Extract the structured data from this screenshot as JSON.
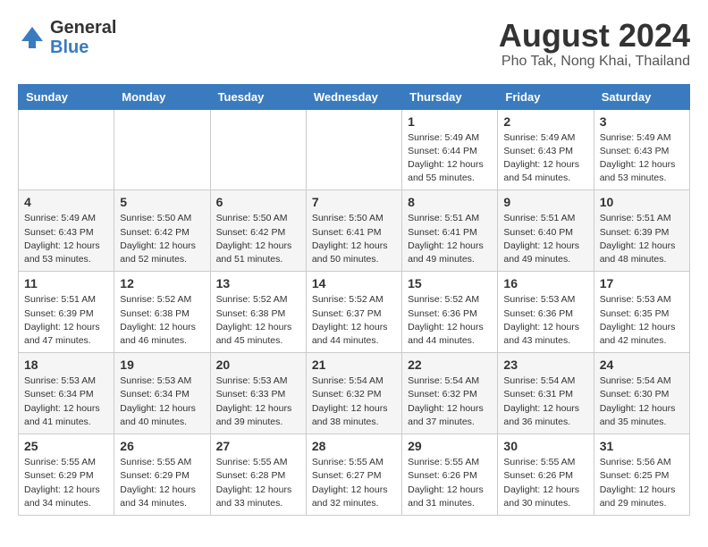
{
  "header": {
    "logo_general": "General",
    "logo_blue": "Blue",
    "title": "August 2024",
    "subtitle": "Pho Tak, Nong Khai, Thailand"
  },
  "calendar": {
    "days_of_week": [
      "Sunday",
      "Monday",
      "Tuesday",
      "Wednesday",
      "Thursday",
      "Friday",
      "Saturday"
    ],
    "weeks": [
      [
        {
          "day": "",
          "info": ""
        },
        {
          "day": "",
          "info": ""
        },
        {
          "day": "",
          "info": ""
        },
        {
          "day": "",
          "info": ""
        },
        {
          "day": "1",
          "info": "Sunrise: 5:49 AM\nSunset: 6:44 PM\nDaylight: 12 hours\nand 55 minutes."
        },
        {
          "day": "2",
          "info": "Sunrise: 5:49 AM\nSunset: 6:43 PM\nDaylight: 12 hours\nand 54 minutes."
        },
        {
          "day": "3",
          "info": "Sunrise: 5:49 AM\nSunset: 6:43 PM\nDaylight: 12 hours\nand 53 minutes."
        }
      ],
      [
        {
          "day": "4",
          "info": "Sunrise: 5:49 AM\nSunset: 6:43 PM\nDaylight: 12 hours\nand 53 minutes."
        },
        {
          "day": "5",
          "info": "Sunrise: 5:50 AM\nSunset: 6:42 PM\nDaylight: 12 hours\nand 52 minutes."
        },
        {
          "day": "6",
          "info": "Sunrise: 5:50 AM\nSunset: 6:42 PM\nDaylight: 12 hours\nand 51 minutes."
        },
        {
          "day": "7",
          "info": "Sunrise: 5:50 AM\nSunset: 6:41 PM\nDaylight: 12 hours\nand 50 minutes."
        },
        {
          "day": "8",
          "info": "Sunrise: 5:51 AM\nSunset: 6:41 PM\nDaylight: 12 hours\nand 49 minutes."
        },
        {
          "day": "9",
          "info": "Sunrise: 5:51 AM\nSunset: 6:40 PM\nDaylight: 12 hours\nand 49 minutes."
        },
        {
          "day": "10",
          "info": "Sunrise: 5:51 AM\nSunset: 6:39 PM\nDaylight: 12 hours\nand 48 minutes."
        }
      ],
      [
        {
          "day": "11",
          "info": "Sunrise: 5:51 AM\nSunset: 6:39 PM\nDaylight: 12 hours\nand 47 minutes."
        },
        {
          "day": "12",
          "info": "Sunrise: 5:52 AM\nSunset: 6:38 PM\nDaylight: 12 hours\nand 46 minutes."
        },
        {
          "day": "13",
          "info": "Sunrise: 5:52 AM\nSunset: 6:38 PM\nDaylight: 12 hours\nand 45 minutes."
        },
        {
          "day": "14",
          "info": "Sunrise: 5:52 AM\nSunset: 6:37 PM\nDaylight: 12 hours\nand 44 minutes."
        },
        {
          "day": "15",
          "info": "Sunrise: 5:52 AM\nSunset: 6:36 PM\nDaylight: 12 hours\nand 44 minutes."
        },
        {
          "day": "16",
          "info": "Sunrise: 5:53 AM\nSunset: 6:36 PM\nDaylight: 12 hours\nand 43 minutes."
        },
        {
          "day": "17",
          "info": "Sunrise: 5:53 AM\nSunset: 6:35 PM\nDaylight: 12 hours\nand 42 minutes."
        }
      ],
      [
        {
          "day": "18",
          "info": "Sunrise: 5:53 AM\nSunset: 6:34 PM\nDaylight: 12 hours\nand 41 minutes."
        },
        {
          "day": "19",
          "info": "Sunrise: 5:53 AM\nSunset: 6:34 PM\nDaylight: 12 hours\nand 40 minutes."
        },
        {
          "day": "20",
          "info": "Sunrise: 5:53 AM\nSunset: 6:33 PM\nDaylight: 12 hours\nand 39 minutes."
        },
        {
          "day": "21",
          "info": "Sunrise: 5:54 AM\nSunset: 6:32 PM\nDaylight: 12 hours\nand 38 minutes."
        },
        {
          "day": "22",
          "info": "Sunrise: 5:54 AM\nSunset: 6:32 PM\nDaylight: 12 hours\nand 37 minutes."
        },
        {
          "day": "23",
          "info": "Sunrise: 5:54 AM\nSunset: 6:31 PM\nDaylight: 12 hours\nand 36 minutes."
        },
        {
          "day": "24",
          "info": "Sunrise: 5:54 AM\nSunset: 6:30 PM\nDaylight: 12 hours\nand 35 minutes."
        }
      ],
      [
        {
          "day": "25",
          "info": "Sunrise: 5:55 AM\nSunset: 6:29 PM\nDaylight: 12 hours\nand 34 minutes."
        },
        {
          "day": "26",
          "info": "Sunrise: 5:55 AM\nSunset: 6:29 PM\nDaylight: 12 hours\nand 34 minutes."
        },
        {
          "day": "27",
          "info": "Sunrise: 5:55 AM\nSunset: 6:28 PM\nDaylight: 12 hours\nand 33 minutes."
        },
        {
          "day": "28",
          "info": "Sunrise: 5:55 AM\nSunset: 6:27 PM\nDaylight: 12 hours\nand 32 minutes."
        },
        {
          "day": "29",
          "info": "Sunrise: 5:55 AM\nSunset: 6:26 PM\nDaylight: 12 hours\nand 31 minutes."
        },
        {
          "day": "30",
          "info": "Sunrise: 5:55 AM\nSunset: 6:26 PM\nDaylight: 12 hours\nand 30 minutes."
        },
        {
          "day": "31",
          "info": "Sunrise: 5:56 AM\nSunset: 6:25 PM\nDaylight: 12 hours\nand 29 minutes."
        }
      ]
    ]
  }
}
